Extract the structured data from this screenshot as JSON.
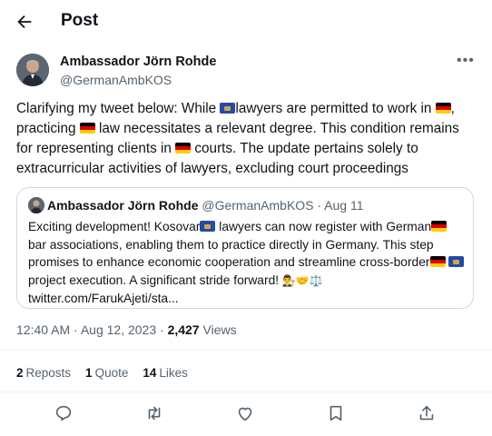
{
  "header": {
    "title": "Post"
  },
  "author": {
    "name": "Ambassador Jörn Rohde",
    "handle": "@GermanAmbKOS"
  },
  "tweet": {
    "p1": "Clarifying my tweet below: While ",
    "p2": "lawyers are permitted to work in ",
    "p3": ",",
    "p4": "practicing ",
    "p5": " law necessitates a relevant degree. This condition remains for representing clients in ",
    "p6": " courts. The update pertains solely to extracurricular activities of lawyers, excluding court proceedings"
  },
  "quote": {
    "name": "Ambassador Jörn Rohde",
    "meta": "@GermanAmbKOS · Aug 11",
    "t1": "Exciting development! Kosovar",
    "t2": " lawyers can now register with German",
    "t3": "bar associations, enabling them to practice directly in Germany. This step promises to enhance economic cooperation and streamline cross-border",
    "t4": " project execution. A significant stride forward! ",
    "emojis": "👨‍⚖️🤝⚖️",
    "link": "twitter.com/FarukAjeti/sta..."
  },
  "timestamp": {
    "time": "12:40 AM · Aug 12, 2023 · ",
    "views_count": "2,427",
    "views_label": " Views"
  },
  "stats": {
    "reposts_count": "2",
    "reposts_label": "Reposts",
    "quotes_count": "1",
    "quotes_label": "Quote",
    "likes_count": "14",
    "likes_label": "Likes"
  },
  "icons": {
    "back": "arrow-left-icon",
    "more": "more-horizontal-icon",
    "reply": "reply-icon",
    "repost": "repost-icon",
    "like": "heart-icon",
    "bookmark": "bookmark-icon",
    "share": "share-icon",
    "flag_kosovo": "kosovo-flag-icon",
    "flag_germany": "germany-flag-icon"
  },
  "colors": {
    "text": "#0f1419",
    "secondary": "#536471",
    "border": "#cfd9de"
  }
}
